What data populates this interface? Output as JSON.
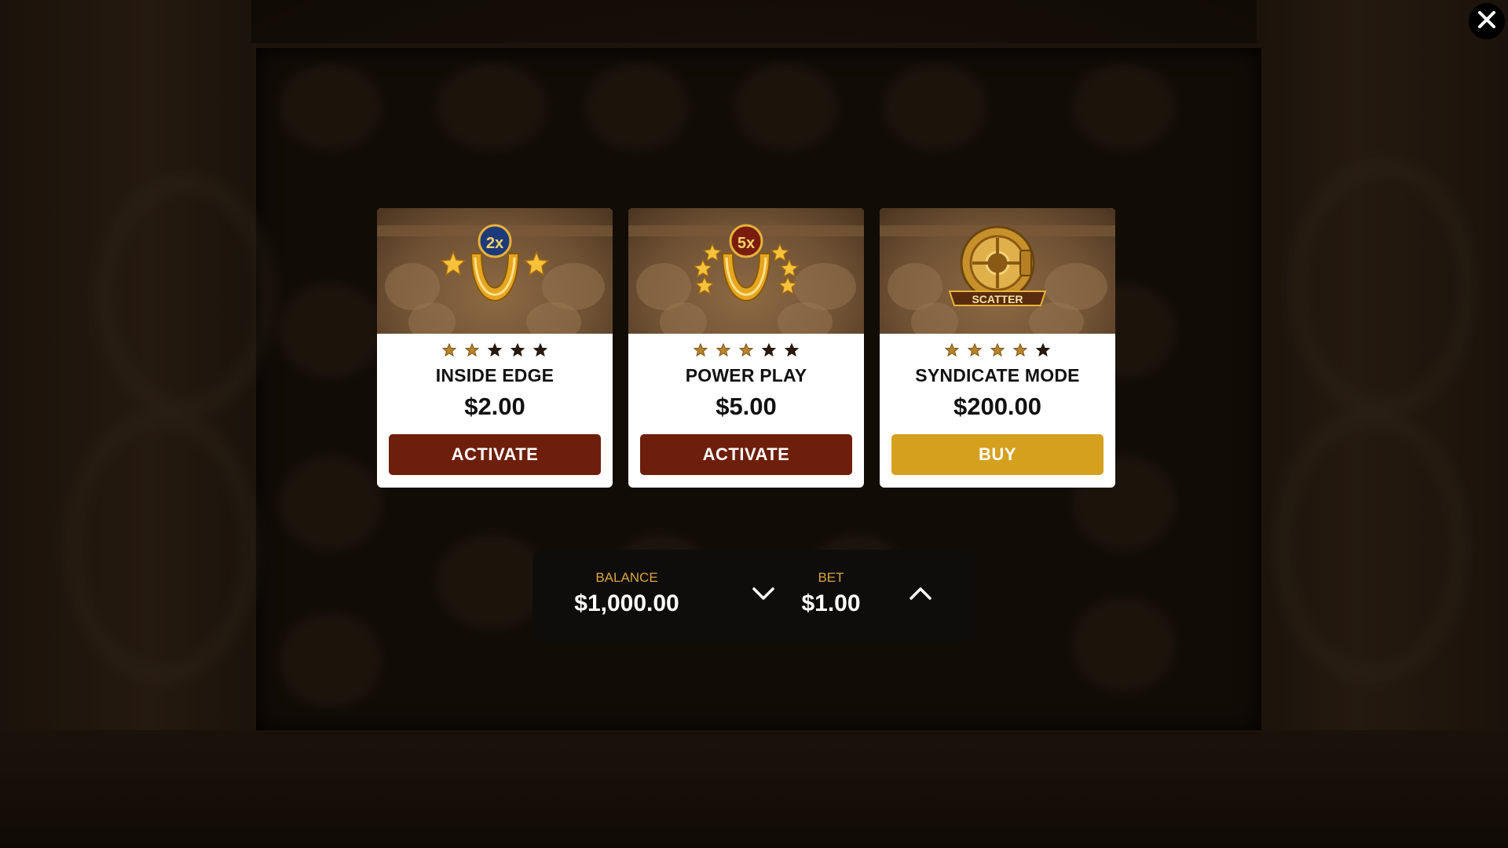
{
  "close": {
    "icon": "close-icon"
  },
  "cards": [
    {
      "badge": "2x",
      "icon": "horseshoe-icon",
      "rating": 2,
      "rating_max": 5,
      "title": "INSIDE EDGE",
      "price": "$2.00",
      "button": "ACTIVATE"
    },
    {
      "badge": "5x",
      "icon": "horseshoe-icon",
      "rating": 3,
      "rating_max": 5,
      "title": "POWER PLAY",
      "price": "$5.00",
      "button": "ACTIVATE"
    },
    {
      "badge": "SCATTER",
      "icon": "vault-icon",
      "rating": 4,
      "rating_max": 5,
      "title": "SYNDICATE MODE",
      "price": "$200.00",
      "button": "BUY"
    }
  ],
  "panel": {
    "balance_label": "BALANCE",
    "balance_value": "$1,000.00",
    "bet_label": "BET",
    "bet_value": "$1.00"
  },
  "colors": {
    "activate_button": "#6e1f0b",
    "buy_button": "#d6a01f",
    "panel_label": "#d9a441",
    "star_filled": "#b8832a",
    "star_empty": "#2a1a0e"
  }
}
